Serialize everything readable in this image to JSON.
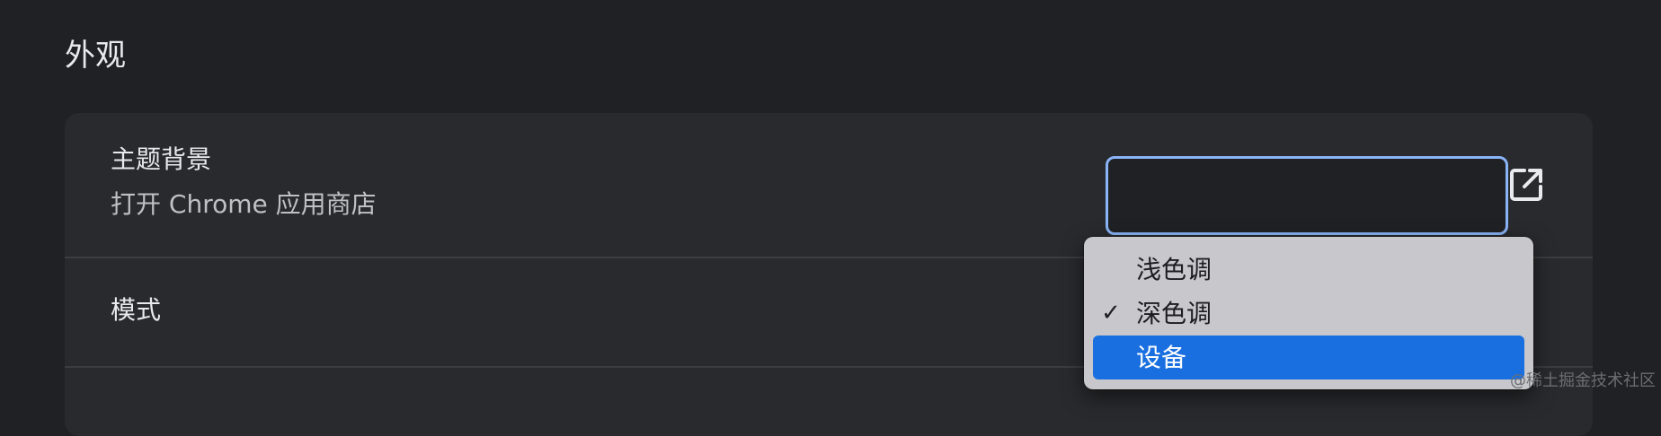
{
  "section": {
    "title": "外观"
  },
  "theme_row": {
    "label": "主题背景",
    "sublabel": "打开 Chrome 应用商店",
    "icon": "open-in-new-icon"
  },
  "mode_row": {
    "label": "模式"
  },
  "mode_dropdown": {
    "checked_value": "深色调",
    "highlighted_value": "设备",
    "options": [
      {
        "label": "浅色调",
        "check": ""
      },
      {
        "label": "深色调",
        "check": "✓"
      },
      {
        "label": "设备",
        "check": ""
      }
    ]
  },
  "colors": {
    "background": "#202124",
    "card": "#292a2d",
    "accent": "#8ab4f8",
    "menu_highlight": "#1a6fe0"
  },
  "watermark": "@稀土掘金技术社区"
}
